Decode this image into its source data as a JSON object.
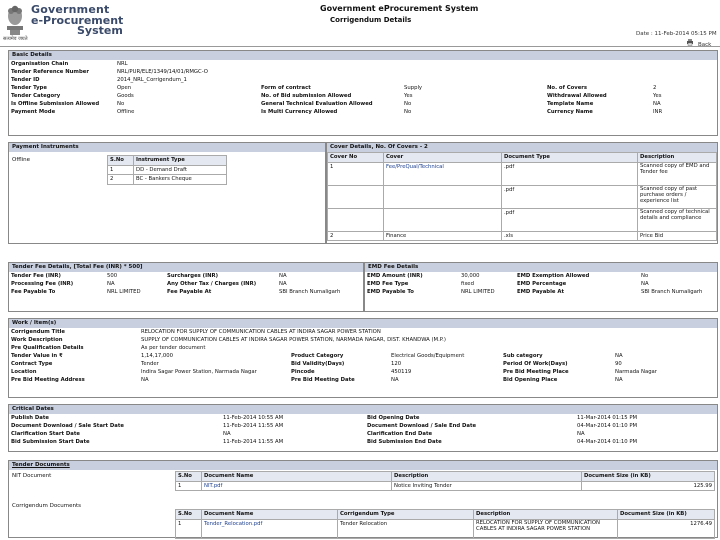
{
  "header": {
    "brand_line1": "Government",
    "brand_line2": "e-Procurement",
    "brand_line3": "System",
    "emblem_caption": "सत्यमेव जयते",
    "system_title": "Government eProcurement System",
    "page_title": "Corrigendum Details",
    "date": "Date : 11-Feb-2014 05:15 PM",
    "back_label": "Back"
  },
  "basic": {
    "title": "Basic Details",
    "rows": [
      [
        "Organisation Chain",
        "NRL",
        "",
        ""
      ],
      [
        "Tender Reference Number",
        "NRL/PUR/ELE/1349/14/01/RMGC-O",
        "",
        ""
      ],
      [
        "Tender ID",
        "2014_NRL_Corrigendum_1",
        "",
        ""
      ],
      [
        "Tender Type",
        "Open",
        "Form of contract",
        "Supply"
      ],
      [
        "Tender Category",
        "Goods",
        "No. of Bid submission Allowed",
        "Yes"
      ],
      [
        "Is Offline Submission Allowed",
        "No",
        "General Technical Evaluation Allowed",
        "No"
      ],
      [
        "Payment Mode",
        "Offline",
        "Is Multi Currency Allowed",
        "No"
      ]
    ],
    "rows_right": [
      [
        "No. of Covers",
        "2"
      ],
      [
        "Withdrawal Allowed",
        "Yes"
      ],
      [
        "Template Name",
        "NA"
      ],
      [
        "Currency Name",
        "INR"
      ]
    ]
  },
  "payment": {
    "title": "Payment Instruments",
    "mode": "Offline",
    "headers": [
      "S.No",
      "Instrument Type"
    ],
    "rows": [
      [
        "1",
        "DD - Demand Draft"
      ],
      [
        "2",
        "BC - Bankers Cheque"
      ]
    ]
  },
  "covers": {
    "title": "Cover Details, No. Of Covers - 2",
    "headers": [
      "Cover No",
      "Cover",
      "Document Type",
      "Description"
    ],
    "rows": [
      [
        "1",
        "Fee/PreQual/Technical",
        ".pdf",
        "Scanned copy of EMD and Tender fee"
      ],
      [
        "",
        "",
        ".pdf",
        "Scanned copy of past purchase orders / experience list"
      ],
      [
        "",
        "",
        ".pdf",
        "Scanned copy of technical details and compliance"
      ],
      [
        "2",
        "Finance",
        ".xls",
        "Price Bid"
      ]
    ]
  },
  "fee": {
    "title": "Tender Fee Details, [Total Fee (INR) * 500]",
    "rows": [
      [
        "Tender Fee (INR)",
        "500",
        "Surcharges (INR)",
        "NA"
      ],
      [
        "Processing Fee (INR)",
        "NA",
        "Any Other Tax / Charges (INR)",
        "NA"
      ],
      [
        "Fee Payable To",
        "NRL LIMITED",
        "Fee Payable At",
        "SBI Branch Numaligarh"
      ]
    ]
  },
  "emd": {
    "title": "EMD Fee Details",
    "rows": [
      [
        "EMD Amount (INR)",
        "30,000",
        "EMD Exemption Allowed",
        "No"
      ],
      [
        "EMD Fee Type",
        "fixed",
        "EMD Percentage",
        "NA"
      ],
      [
        "EMD Payable To",
        "NRL LIMITED",
        "EMD Payable At",
        "SBI Branch Numaligarh"
      ]
    ]
  },
  "work": {
    "title": "Work / Item(s)",
    "title_label": "Corrigendum Title",
    "title_value": "RELOCATION FOR SUPPLY OF COMMUNICATION CABLES AT INDIRA SAGAR POWER STATION",
    "desc_label": "Work Description",
    "desc_value": "SUPPLY OF COMMUNICATION CABLES AT INDIRA SAGAR POWER STATION, NARMADA NAGAR, DIST. KHANDWA (M.P.)",
    "prequal_label": "Pre Qualification Details",
    "prequal_value": "As per tender document",
    "rows": [
      [
        "Tender Value in ₹",
        "1,14,17,000",
        "Product Category",
        "Electrical Goods/Equipment",
        "Sub category",
        "NA"
      ],
      [
        "Contract Type",
        "Tender",
        "Bid Validity(Days)",
        "120",
        "Period Of Work(Days)",
        "90"
      ],
      [
        "Location",
        "Indira Sagar Power Station, Narmada Nagar",
        "Pincode",
        "450119",
        "Pre Bid Meeting Place",
        "Narmada Nagar"
      ],
      [
        "Pre Bid Meeting Address",
        "NA",
        "Pre Bid Meeting Date",
        "NA",
        "Bid Opening Place",
        "NA"
      ]
    ]
  },
  "dates": {
    "title": "Critical Dates",
    "rows": [
      [
        "Publish Date",
        "11-Feb-2014 10:55 AM",
        "Bid Opening Date",
        "11-Mar-2014 01:15 PM"
      ],
      [
        "Document Download / Sale Start Date",
        "11-Feb-2014 11:55 AM",
        "Document Download / Sale End Date",
        "04-Mar-2014 01:10 PM"
      ],
      [
        "Clarification Start Date",
        "NA",
        "Clarification End Date",
        "NA"
      ],
      [
        "Bid Submission Start Date",
        "11-Feb-2014 11:55 AM",
        "Bid Submission End Date",
        "04-Mar-2014 01:10 PM"
      ]
    ]
  },
  "docs": {
    "title": "Tender Documents",
    "nit_label": "NIT Document",
    "headers": [
      "S.No",
      "Document Name",
      "Description",
      "Document Size (in KB)"
    ],
    "nit_rows": [
      [
        "1",
        "NIT.pdf",
        "Notice Inviting Tender",
        "125.99"
      ]
    ],
    "corr_label": "Corrigendum Documents",
    "corr_headers": [
      "S.No",
      "Document Name",
      "Corrigendum Type",
      "Description",
      "Document Size (in KB)"
    ],
    "corr_rows": [
      [
        "1",
        "Tender_Relocation.pdf",
        "Tender Relocation",
        "RELOCATION FOR SUPPLY OF COMMUNICATION CABLES AT INDIRA SAGAR POWER STATION",
        "1276.49"
      ]
    ]
  }
}
